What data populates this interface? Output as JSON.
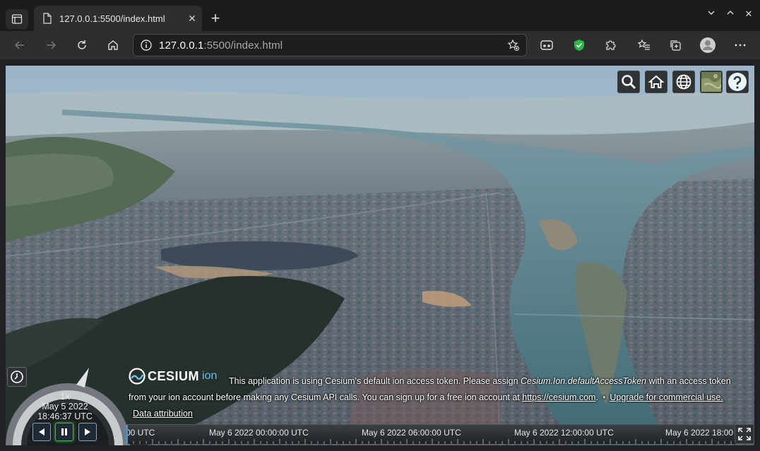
{
  "browser": {
    "tab_title": "127.0.0.1:5500/index.html",
    "url_host": "127.0.0.1",
    "url_rest": ":5500/index.html"
  },
  "cesium": {
    "toolbar": [
      "search-icon",
      "home-icon",
      "globe-icon",
      "layers-icon",
      "help-icon"
    ],
    "logo_word": "CESIUM",
    "logo_ion": "ion",
    "credit": {
      "message_start": "This application is using Cesium's default ion access token. Please assign ",
      "message_em": "Cesium.Ion.defaultAccessToken",
      "message_end": " with an access token from your ion account before making any Cesium API calls. You can sign up for a free ion account at ",
      "link_url": "https://cesium.com",
      "message_tail": ".",
      "upgrade_link": "Upgrade for commercial use.",
      "attribution_link": "Data attribution"
    },
    "animation": {
      "speed": "1x",
      "date": "May 5 2022",
      "time": "18:46:37 UTC"
    },
    "timeline_labels": [
      "00 UTC",
      "May 6 2022 00:00:00 UTC",
      "May 6 2022 06:00:00 UTC",
      "May 6 2022 12:00:00 UTC",
      "May 6 2022 18:00"
    ],
    "accent_color": "#6fbfe8",
    "play_active_color": "#4caf50"
  }
}
